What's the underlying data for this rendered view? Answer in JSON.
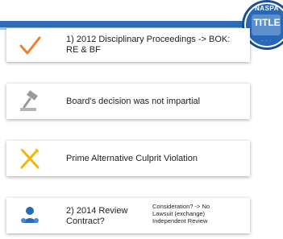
{
  "badge": {
    "top_text": "NASPA",
    "main_text": "TITLE",
    "arc_text": "· · ·"
  },
  "cards": [
    {
      "text": "1) 2012 Disciplinary Proceedings -> BOK: RE & BF",
      "icon": "check-icon",
      "icon_color": "#f07e2e"
    },
    {
      "text": "Board’s decision was not impartial",
      "icon": "gavel-icon",
      "icon_color": "#9a9a9a"
    },
    {
      "text": "Prime Alternative Culprit Violation",
      "icon": "fork-knife-cross-icon",
      "icon_color": "#f2b705"
    },
    {
      "text": "2) 2014 Review Contract?",
      "icon": "people-icon",
      "icon_color": "#2a6bb5",
      "notes": [
        "Consideration? -> No",
        "Lawsuit (exchange)",
        "Independent Review"
      ]
    }
  ]
}
